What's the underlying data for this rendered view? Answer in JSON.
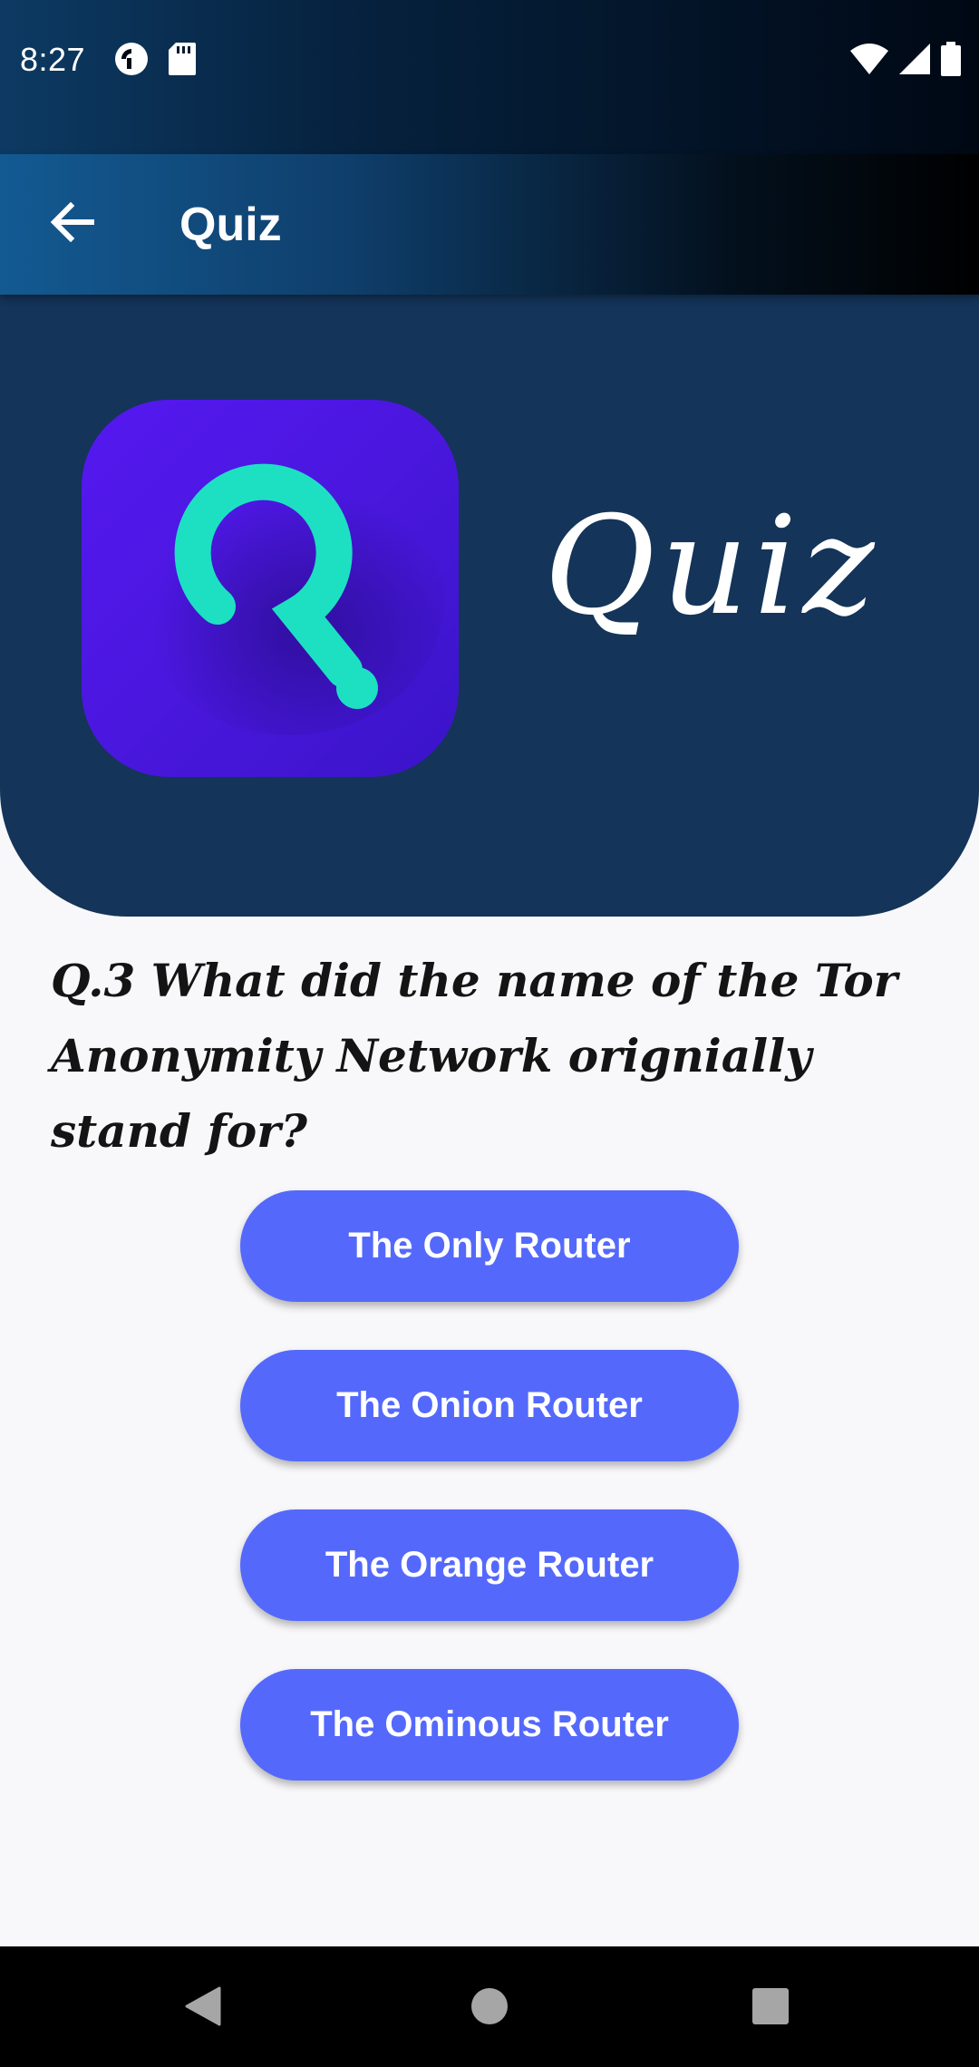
{
  "status_bar": {
    "time": "8:27",
    "left_icons": [
      "pocket-casts-icon",
      "sd-card-icon"
    ],
    "right_icons": [
      "wifi-icon",
      "cellular-signal-icon",
      "battery-icon"
    ]
  },
  "app_bar": {
    "title": "Quiz",
    "back_icon": "arrow-back-icon"
  },
  "banner": {
    "logo_icon": "quiz-logo-icon",
    "title": "Quiz"
  },
  "question": {
    "text": "Q.3 What did the name of the Tor Anonymity Network orignially stand for?"
  },
  "answers": [
    {
      "label": "The Only Router"
    },
    {
      "label": "The Onion Router"
    },
    {
      "label": "The Orange Router"
    },
    {
      "label": "The Ominous Router"
    }
  ],
  "nav_bar": {
    "icons": [
      "back-triangle-icon",
      "home-circle-icon",
      "recents-square-icon"
    ]
  },
  "colors": {
    "banner": "#143459",
    "button": "#5469fb",
    "logo_bg": "#4a17de",
    "logo_mark": "#1de0c3"
  }
}
